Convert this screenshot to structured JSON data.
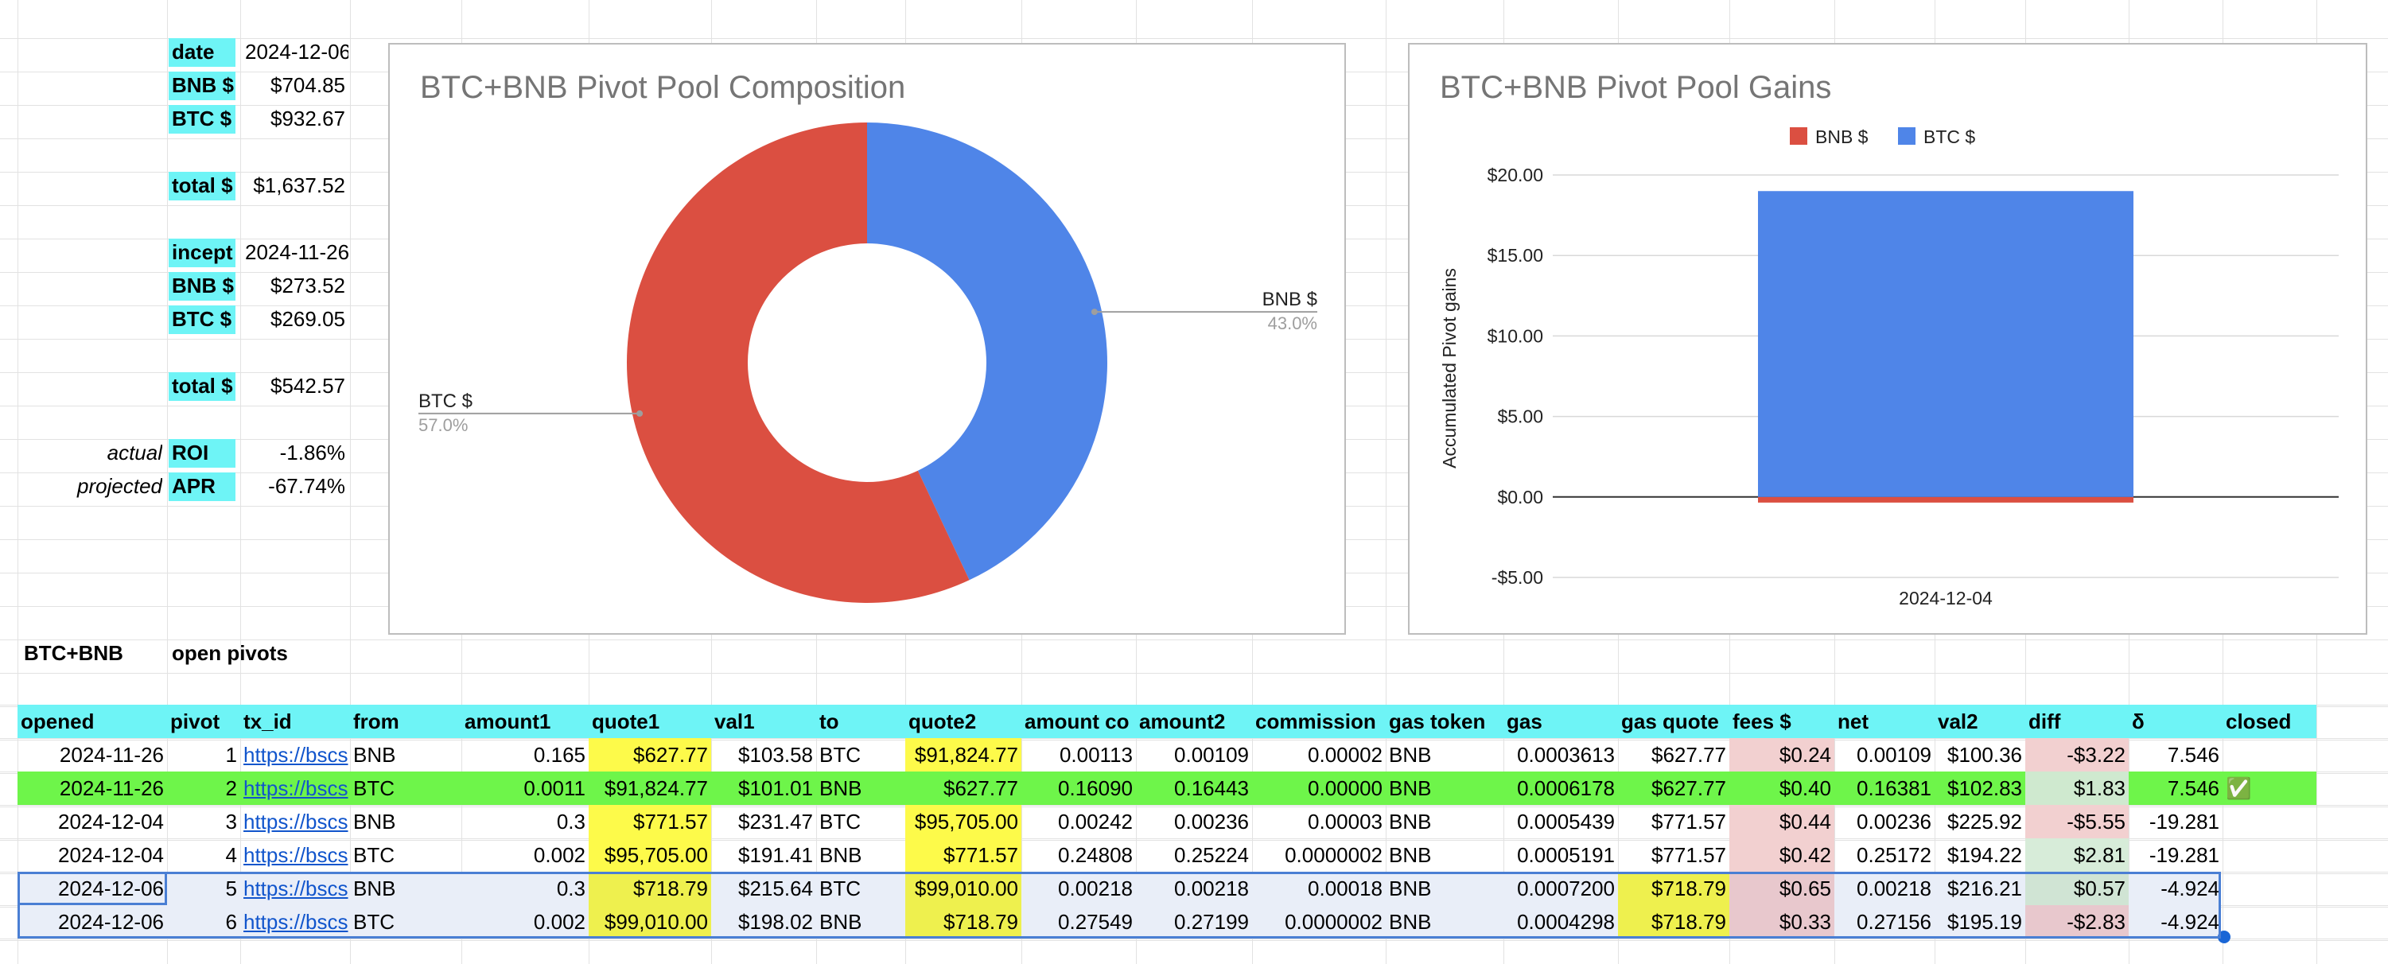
{
  "summary": {
    "date_label": "date",
    "date_value": "2024-12-06",
    "bnb_label": "BNB $",
    "bnb_value": "$704.85",
    "btc_label": "BTC $",
    "btc_value": "$932.67",
    "total_label": "total $",
    "total_value": "$1,637.52",
    "incept_label": "incept",
    "incept_value": "2024-11-26",
    "bnb2_label": "BNB $",
    "bnb2_value": "$273.52",
    "btc2_label": "BTC $",
    "btc2_value": "$269.05",
    "total2_label": "total $",
    "total2_value": "$542.57",
    "roi_note": "actual",
    "roi_label": "ROI",
    "roi_value": "-1.86%",
    "apr_note": "projected",
    "apr_label": "APR",
    "apr_value": "-67.74%"
  },
  "chart_data": [
    {
      "type": "pie",
      "title": "BTC+BNB Pivot Pool Composition",
      "labels": [
        "BNB $",
        "BTC $"
      ],
      "values": [
        43.0,
        57.0
      ],
      "percent_labels": [
        "43.0%",
        "57.0%"
      ],
      "colors": [
        "#4f85e8",
        "#db4f41"
      ]
    },
    {
      "type": "bar",
      "title": "BTC+BNB Pivot Pool Gains",
      "categories": [
        "2024-12-04"
      ],
      "series": [
        {
          "name": "BNB $",
          "values": [
            -0.35
          ],
          "color": "#db4f41"
        },
        {
          "name": "BTC $",
          "values": [
            19.0
          ],
          "color": "#4f85e8"
        }
      ],
      "ylabel": "Accumulated Pivot gains",
      "ylim": [
        -5,
        20
      ],
      "ticks": [
        "$20.00",
        "$15.00",
        "$10.00",
        "$5.00",
        "$0.00",
        "-$5.00"
      ],
      "legend": "top"
    }
  ],
  "table": {
    "section_label": "BTC+BNB",
    "section_title": "open pivots",
    "headers": [
      "opened",
      "pivot",
      "tx_id",
      "from",
      "amount1",
      "quote1",
      "val1",
      "to",
      "quote2",
      "amount co",
      "amount2",
      "commission",
      "gas token",
      "gas",
      "gas quote",
      "fees $",
      "net",
      "val2",
      "diff",
      "δ",
      "closed"
    ],
    "rows": [
      [
        "2024-11-26",
        "1",
        "https://bscs",
        "BNB",
        "0.165",
        "$627.77",
        "$103.58",
        "BTC",
        "$91,824.77",
        "0.00113",
        "0.00109",
        "0.00002",
        "BNB",
        "0.0003613",
        "$627.77",
        "$0.24",
        "0.00109",
        "$100.36",
        "-$3.22",
        "7.546",
        ""
      ],
      [
        "2024-11-26",
        "2",
        "https://bscs",
        "BTC",
        "0.0011",
        "$91,824.77",
        "$101.01",
        "BNB",
        "$627.77",
        "0.16090",
        "0.16443",
        "0.00000",
        "BNB",
        "0.0006178",
        "$627.77",
        "$0.40",
        "0.16381",
        "$102.83",
        "$1.83",
        "7.546",
        "✅"
      ],
      [
        "2024-12-04",
        "3",
        "https://bscs",
        "BNB",
        "0.3",
        "$771.57",
        "$231.47",
        "BTC",
        "$95,705.00",
        "0.00242",
        "0.00236",
        "0.00003",
        "BNB",
        "0.0005439",
        "$771.57",
        "$0.44",
        "0.00236",
        "$225.92",
        "-$5.55",
        "-19.281",
        ""
      ],
      [
        "2024-12-04",
        "4",
        "https://bscs",
        "BTC",
        "0.002",
        "$95,705.00",
        "$191.41",
        "BNB",
        "$771.57",
        "0.24808",
        "0.25224",
        "0.0000002",
        "BNB",
        "0.0005191",
        "$771.57",
        "$0.42",
        "0.25172",
        "$194.22",
        "$2.81",
        "-19.281",
        ""
      ],
      [
        "2024-12-06",
        "5",
        "https://bscs",
        "BNB",
        "0.3",
        "$718.79",
        "$215.64",
        "BTC",
        "$99,010.00",
        "0.00218",
        "0.00218",
        "0.00018",
        "BNB",
        "0.0007200",
        "$718.79",
        "$0.65",
        "0.00218",
        "$216.21",
        "$0.57",
        "-4.924",
        ""
      ],
      [
        "2024-12-06",
        "6",
        "https://bscs",
        "BTC",
        "0.002",
        "$99,010.00",
        "$198.02",
        "BNB",
        "$718.79",
        "0.27549",
        "0.27199",
        "0.0000002",
        "BNB",
        "0.0004298",
        "$718.79",
        "$0.33",
        "0.27156",
        "$195.19",
        "-$2.83",
        "-4.924",
        ""
      ]
    ]
  }
}
